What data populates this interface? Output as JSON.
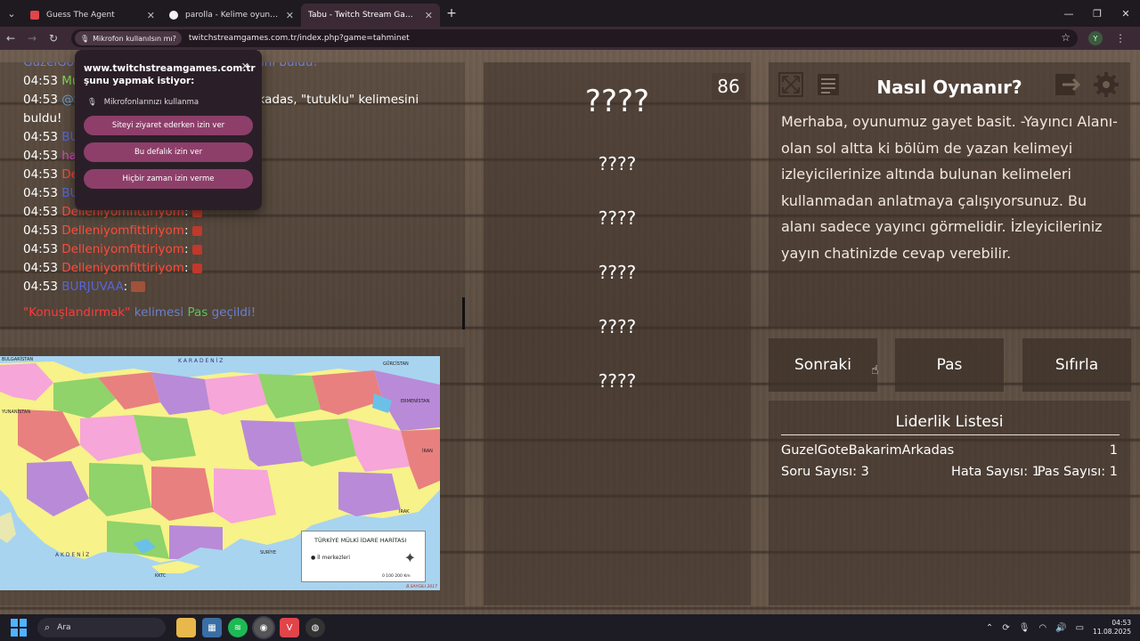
{
  "browser": {
    "tabs": [
      {
        "label": "Guess The Agent",
        "favicon_color": "#e0454a"
      },
      {
        "label": "parolla - Kelime oyunu. Günlük",
        "favicon_color": "#f2f2f2"
      },
      {
        "label": "Tabu - Twitch Stream Games",
        "favicon_color": "#9146ff"
      }
    ],
    "permission_chip": "Mikrofon kullanılsın mı?",
    "url": "twitchstreamgames.com.tr/index.php?game=tahminet",
    "profile_initial": "Y"
  },
  "permission_popup": {
    "title": "www.twitchstreamgames.com.tr şunu yapmak istiyor:",
    "mic_request": "Mikrofonlarınızı kullanma",
    "buttons": [
      "Siteyi ziyaret ederken izin ver",
      "Bu defalık izin ver",
      "Hiçbir zaman izin verme"
    ]
  },
  "chat": {
    "lines": [
      {
        "time": "",
        "user": "GuzelGo",
        "user_color": "#6a7fd0",
        "text": "",
        "extra": "sini buldu!",
        "extra_color": "#6a7fd0"
      },
      {
        "time": "04:53",
        "user": "Mu",
        "user_color": "#7ed957",
        "text": "",
        "extra": "",
        "extra_color": "#fff"
      },
      {
        "time": "04:53",
        "user": "@S",
        "user_color": "#6a9fd0",
        "text": "",
        "extra": "rkadas, \"tutuklu\" kelimesini",
        "extra_color": "#fff"
      },
      {
        "time": "",
        "user": "",
        "user_color": "#fff",
        "text": "buldu!",
        "extra": "",
        "extra_color": "#fff"
      },
      {
        "time": "04:53",
        "user": "BU",
        "user_color": "#5566dd",
        "text": "",
        "extra": "",
        "extra_color": "#fff"
      },
      {
        "time": "04:53",
        "user": "ha",
        "user_color": "#e040c8",
        "text": "",
        "extra": "",
        "extra_color": "#fff"
      },
      {
        "time": "04:53",
        "user": "De",
        "user_color": "#ff4a3a",
        "text": "",
        "extra": "",
        "extra_color": "#fff"
      },
      {
        "time": "04:53",
        "user": "BU",
        "user_color": "#5566dd",
        "text": "",
        "extra": "",
        "extra_color": "#fff"
      },
      {
        "time": "04:53",
        "user": "Delleniyomfittiriyom",
        "user_color": "#ff4a3a",
        "text": ":",
        "extra": "",
        "extra_color": "#fff"
      },
      {
        "time": "04:53",
        "user": "Delleniyomfittiriyom",
        "user_color": "#ff4a3a",
        "text": ":",
        "extra": "",
        "extra_color": "#fff"
      },
      {
        "time": "04:53",
        "user": "Delleniyomfittiriyom",
        "user_color": "#ff4a3a",
        "text": ":",
        "extra": "",
        "extra_color": "#fff"
      },
      {
        "time": "04:53",
        "user": "Delleniyomfittiriyom",
        "user_color": "#ff4a3a",
        "text": ":",
        "extra": "",
        "extra_color": "#fff"
      },
      {
        "time": "04:53",
        "user": "BURJUVAA",
        "user_color": "#5566dd",
        "text": ":",
        "extra": "",
        "extra_color": "#fff"
      }
    ],
    "pass_line": {
      "word": "\"Konuşlandırmak\"",
      "mid": "kelimesi",
      "pas": "Pas",
      "end": "geçildi!"
    }
  },
  "map": {
    "sea_north": "K A R A D E N İ Z",
    "sea_south": "A K D E N İ Z",
    "country_labels": [
      "BULGARİSTAN",
      "GÜRCİSTAN",
      "ERMENİSTAN",
      "İRAN",
      "IRAK",
      "SURİYE",
      "KKTC",
      "YUNANİSTAN"
    ],
    "legend_title": "TÜRKİYE MÜLKİ İDARE HARİTASI",
    "legend_item": "İl merkezleri",
    "legend_scale": "0   100   200  Km",
    "author": "B.SAYGILI 2017"
  },
  "game": {
    "score": "86",
    "main_word": "????",
    "forbidden": [
      "????",
      "????",
      "????",
      "????",
      "????"
    ]
  },
  "how_to": {
    "title": "Nasıl Oynanır?",
    "text": "Merhaba, oyunumuz gayet basit. -Yayıncı Alanı-olan sol altta ki bölüm de yazan kelimeyi izleyicilerinize altında bulunan kelimeleri kullanmadan anlatmaya çalışıyorsunuz. Bu alanı sadece yayıncı görmelidir. İzleyicileriniz yayın chatinizde cevap verebilir."
  },
  "actions": {
    "next": "Sonraki",
    "pass": "Pas",
    "reset": "Sıfırla"
  },
  "leaderboard": {
    "title": "Liderlik Listesi",
    "entries": [
      {
        "name": "GuzelGoteBakarimArkadas",
        "score": "1"
      }
    ],
    "questions": "Soru Sayısı: 3",
    "errors": "Hata Sayısı: 1",
    "passes": "Pas Sayısı: 1"
  },
  "taskbar": {
    "search_label": "Ara",
    "time": "04:53",
    "date": "11.08.2025"
  }
}
